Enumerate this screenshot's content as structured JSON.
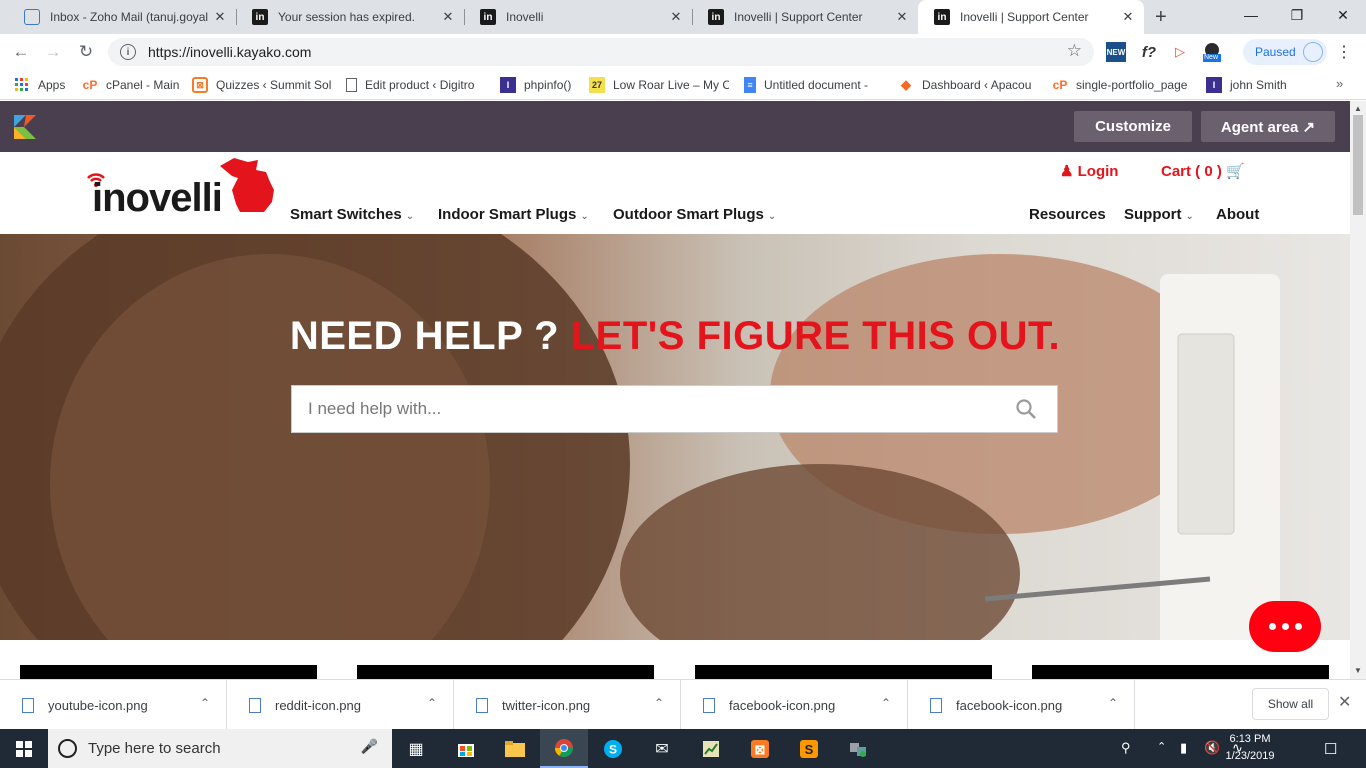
{
  "browser": {
    "tabs": [
      {
        "title": "Inbox - Zoho Mail (tanuj.goyal",
        "favicon": "zoho-mail-icon",
        "active": false
      },
      {
        "title": "Your session has expired.",
        "favicon": "inovelli-icon",
        "active": false
      },
      {
        "title": "Inovelli",
        "favicon": "inovelli-icon",
        "active": false
      },
      {
        "title": "Inovelli | Support Center",
        "favicon": "inovelli-icon",
        "active": false
      },
      {
        "title": "Inovelli | Support Center",
        "favicon": "inovelli-icon",
        "active": true
      }
    ],
    "new_tab": "+",
    "url": "https://inovelli.kayako.com",
    "profile_label": "Paused",
    "new_badge": "New"
  },
  "bookmarks": [
    {
      "label": "Apps",
      "icon": "apps-grid-icon"
    },
    {
      "label": "cPanel - Main",
      "icon": "cpanel-icon"
    },
    {
      "label": "Quizzes ‹ Summit Sol",
      "icon": "xampp-icon"
    },
    {
      "label": "Edit product ‹ Digitro",
      "icon": "page-icon"
    },
    {
      "label": "phpinfo()",
      "icon": "inovelli-icon"
    },
    {
      "label": "Low Roar Live – My C",
      "icon": "calendar-27-icon"
    },
    {
      "label": "Untitled document -",
      "icon": "docs-icon"
    },
    {
      "label": "Dashboard ‹ Apacou",
      "icon": "dashboard-icon"
    },
    {
      "label": "single-portfolio_page",
      "icon": "cpanel-icon"
    },
    {
      "label": "john Smith",
      "icon": "inovelli-icon"
    }
  ],
  "kayako_bar": {
    "customize": "Customize",
    "agent_area": "Agent area ↗"
  },
  "site": {
    "logo_text": "inovelli",
    "login": "Login",
    "cart": "Cart ( 0 )",
    "nav": [
      {
        "label": "Smart Switches",
        "dropdown": true
      },
      {
        "label": "Indoor Smart Plugs",
        "dropdown": true
      },
      {
        "label": "Outdoor Smart Plugs",
        "dropdown": true
      },
      {
        "label": "Resources",
        "dropdown": false
      },
      {
        "label": "Support",
        "dropdown": true
      },
      {
        "label": "About",
        "dropdown": false
      }
    ]
  },
  "hero": {
    "title_white": "NEED HELP ? ",
    "title_red": "LET'S FIGURE THIS OUT.",
    "search_placeholder": "I need help with..."
  },
  "downloads": {
    "items": [
      "youtube-icon.png",
      "reddit-icon.png",
      "twitter-icon.png",
      "facebook-icon.png",
      "facebook-icon.png"
    ],
    "show_all": "Show all"
  },
  "taskbar": {
    "search_placeholder": "Type here to search",
    "time": "6:13 PM",
    "date": "1/23/2019"
  },
  "colors": {
    "brand_red": "#e4141c",
    "kayako_bar": "#4a3f4f",
    "chat_bubble": "#ff0010"
  }
}
